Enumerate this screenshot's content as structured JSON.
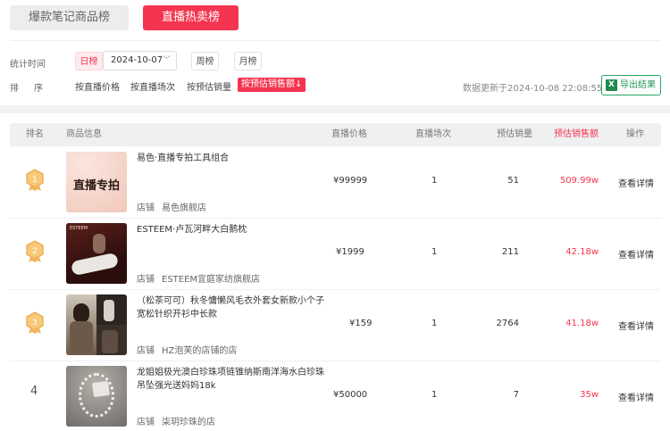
{
  "tabs": [
    {
      "label": "爆款笔记商品榜",
      "active": false
    },
    {
      "label": "直播热卖榜",
      "active": true
    }
  ],
  "filters": {
    "time_label": "统计时间",
    "day_label": "日榜",
    "date_value": "2024-10-07",
    "week_label": "周榜",
    "month_label": "月榜",
    "sort_label": "排序",
    "sort_options": [
      "按直播价格",
      "按直播场次",
      "按预估销量"
    ],
    "sort_active": "按预估销售额↓",
    "update_time": "数据更新于2024-10-08 22:08:55",
    "export_label": "导出结果"
  },
  "table": {
    "headers": {
      "rank": "排名",
      "product": "商品信息",
      "price": "直播价格",
      "sessions": "直播场次",
      "sales": "预估销量",
      "amount": "预估销售额",
      "action": "操作"
    },
    "shop_prefix": "店铺",
    "action_label": "查看详情",
    "rows": [
      {
        "rank": "1",
        "name": "易色·直播专拍工具组合",
        "shop": "易色旗舰店",
        "price": "¥99999",
        "sessions": "1",
        "sales": "51",
        "amount": "509.99w",
        "thumb_text": "直播专拍"
      },
      {
        "rank": "2",
        "name": "ESTEEM·卢瓦河畔大白鹅枕",
        "shop": "ESTEEM宜庭家纺旗舰店",
        "price": "¥1999",
        "sessions": "1",
        "sales": "211",
        "amount": "42.18w",
        "thumb_text": "ESTEEM"
      },
      {
        "rank": "3",
        "name": "（松茶可可）秋冬慵懒风毛衣外套女新款小个子宽松针织开衫中长款",
        "shop": "HZ泡芙的店铺的店",
        "price": "¥159",
        "sessions": "1",
        "sales": "2764",
        "amount": "41.18w",
        "thumb_text": ""
      },
      {
        "rank": "4",
        "name": "龙姐姐极光澳白珍珠项链锥纳斯南洋海水白珍珠吊坠强光送妈妈18k",
        "shop": "柒玥珍珠的店",
        "price": "¥50000",
        "sessions": "1",
        "sales": "7",
        "amount": "35w",
        "thumb_text": ""
      }
    ]
  },
  "colors": {
    "accent": "#f5354f",
    "export_green": "#23985b",
    "medal": "#f4b04d"
  }
}
